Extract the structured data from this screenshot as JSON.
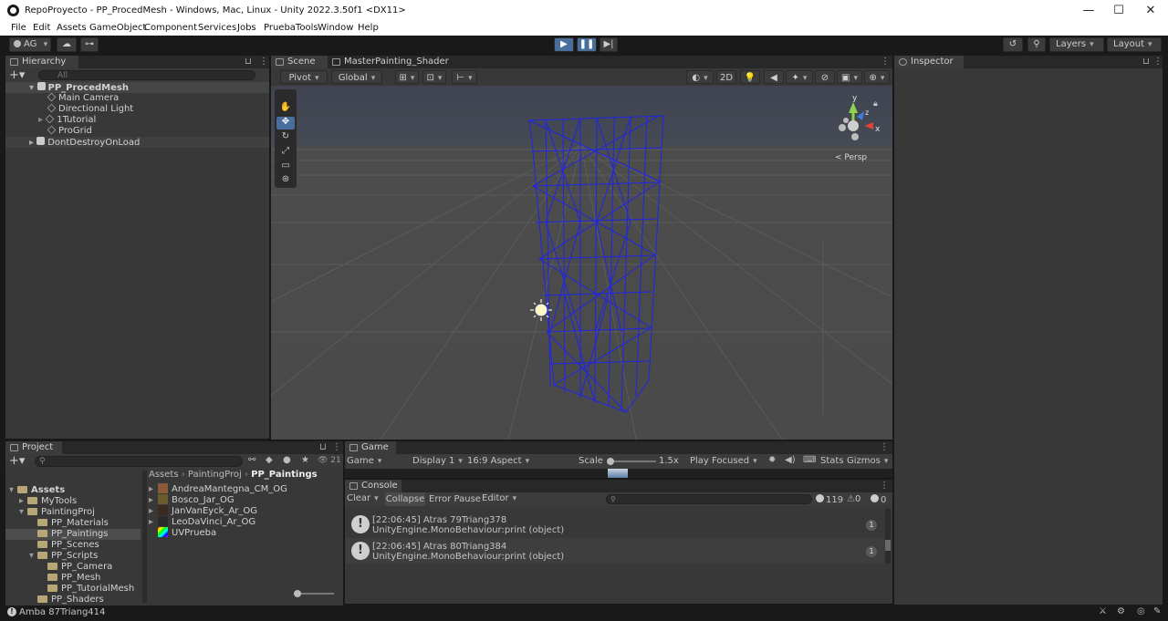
{
  "window": {
    "title": "RepoProyecto - PP_ProcedMesh - Windows, Mac, Linux - Unity 2022.3.50f1 <DX11>",
    "minimize": "—",
    "maximize": "☐",
    "close": "✕"
  },
  "menu": [
    "File",
    "Edit",
    "Assets",
    "GameObject",
    "Component",
    "Services",
    "Jobs",
    "PruebaTools",
    "Window",
    "Help"
  ],
  "toolbar": {
    "account": "AG",
    "layers": "Layers",
    "layout": "Layout"
  },
  "hierarchy": {
    "tab": "Hierarchy",
    "search_placeholder": "All",
    "scene_root": "PP_ProcedMesh",
    "items": [
      "Main Camera",
      "Directional Light",
      "1Tutorial",
      "ProGrid"
    ],
    "ddol": "DontDestroyOnLoad"
  },
  "scene_view": {
    "tabs": [
      "Scene",
      "MasterPainting_Shader"
    ],
    "pivot": "Pivot",
    "global": "Global",
    "mode_2d": "2D",
    "gizmo_y": "y",
    "gizmo_x": "x",
    "gizmo_z": "z",
    "persp": "< Persp"
  },
  "inspector": {
    "tab": "Inspector"
  },
  "project": {
    "tab": "Project",
    "count": "21",
    "tree": [
      {
        "label": "Assets",
        "indent": 0,
        "open": true
      },
      {
        "label": "MyTools",
        "indent": 1,
        "open": false
      },
      {
        "label": "PaintingProj",
        "indent": 1,
        "open": true
      },
      {
        "label": "PP_Materials",
        "indent": 2,
        "open": false
      },
      {
        "label": "PP_Paintings",
        "indent": 2,
        "open": false,
        "selected": true
      },
      {
        "label": "PP_Scenes",
        "indent": 2,
        "open": false
      },
      {
        "label": "PP_Scripts",
        "indent": 2,
        "open": true
      },
      {
        "label": "PP_Camera",
        "indent": 3,
        "open": false
      },
      {
        "label": "PP_Mesh",
        "indent": 3,
        "open": false
      },
      {
        "label": "PP_TutorialMesh",
        "indent": 3,
        "open": false
      },
      {
        "label": "PP_Shaders",
        "indent": 2,
        "open": false
      }
    ],
    "breadcrumb": [
      "Assets",
      "PaintingProj",
      "PP_Paintings"
    ],
    "files": [
      "AndreaMantegna_CM_OG",
      "Bosco_Jar_OG",
      "JanVanEyck_Ar_OG",
      "LeoDaVinci_Ar_OG",
      "UVPrueba"
    ],
    "file_colors": [
      "#8a5a3a",
      "#6b5b2e",
      "#3b2a20",
      "#2a2a2a",
      "#c0c"
    ]
  },
  "game": {
    "tab": "Game",
    "mode": "Game",
    "display": "Display 1",
    "aspect": "16:9 Aspect",
    "scale_label": "Scale",
    "scale_value": "1.5x",
    "play_focused": "Play Focused",
    "stats": "Stats",
    "gizmos": "Gizmos"
  },
  "console": {
    "tab": "Console",
    "clear": "Clear",
    "collapse": "Collapse",
    "error_pause": "Error Pause",
    "editor": "Editor",
    "count_logs": "119",
    "count_warn": "0",
    "count_err": "0",
    "entries": [
      {
        "line1": "[22:06:45] Atras 79Triang378",
        "line2": "UnityEngine.MonoBehaviour:print (object)",
        "count": "1"
      },
      {
        "line1": "[22:06:45] Atras 80Triang384",
        "line2": "UnityEngine.MonoBehaviour:print (object)",
        "count": "1"
      }
    ]
  },
  "status": {
    "message": "Amba 87Triang414"
  }
}
